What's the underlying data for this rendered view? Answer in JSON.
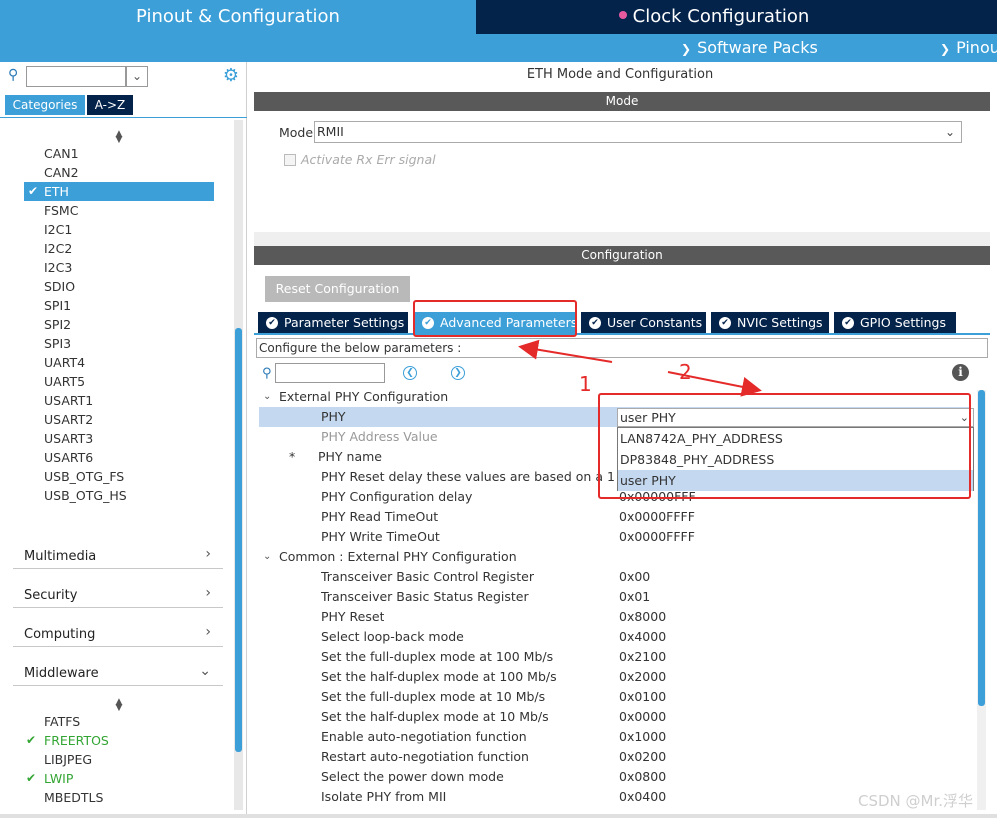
{
  "header": {
    "pinout_tab": "Pinout & Configuration",
    "clock_tab": "Clock Configuration",
    "software_packs": "Software Packs",
    "pinout_menu": "Pinout"
  },
  "left": {
    "categories_tab": "Categories",
    "az_tab": "A->Z",
    "connectivity_items": [
      "CAN1",
      "CAN2",
      "ETH",
      "FSMC",
      "I2C1",
      "I2C2",
      "I2C3",
      "SDIO",
      "SPI1",
      "SPI2",
      "SPI3",
      "UART4",
      "UART5",
      "USART1",
      "USART2",
      "USART3",
      "USART6",
      "USB_OTG_FS",
      "USB_OTG_HS"
    ],
    "groups": [
      "Multimedia",
      "Security",
      "Computing",
      "Middleware"
    ],
    "middleware_items": [
      "FATFS",
      "FREERTOS",
      "LIBJPEG",
      "LWIP",
      "MBEDTLS"
    ]
  },
  "main": {
    "title": "ETH Mode and Configuration",
    "mode_header": "Mode",
    "mode_label": "Mode",
    "mode_value": "RMII",
    "rx_err_label": "Activate Rx Err signal",
    "config_header": "Configuration",
    "reset_button": "Reset Configuration",
    "tabs": [
      "Parameter Settings",
      "Advanced Parameters",
      "User Constants",
      "NVIC Settings",
      "GPIO Settings"
    ],
    "configure_text": "Configure the below parameters :",
    "section1": "External PHY Configuration",
    "phy_rows": [
      {
        "name": "PHY",
        "value": ""
      },
      {
        "name": "PHY Address Value",
        "value": ""
      },
      {
        "name": "PHY name",
        "value": ""
      },
      {
        "name": "PHY Reset delay these values are based on a 1 ...",
        "value": ""
      },
      {
        "name": "PHY Configuration delay",
        "value": "0x00000FFF"
      },
      {
        "name": "PHY Read TimeOut",
        "value": "0x0000FFFF"
      },
      {
        "name": "PHY Write TimeOut",
        "value": "0x0000FFFF"
      }
    ],
    "phy_star": "*",
    "phy_select_value": "user PHY",
    "phy_options": [
      "LAN8742A_PHY_ADDRESS",
      "DP83848_PHY_ADDRESS",
      "user PHY"
    ],
    "section2": "Common : External PHY Configuration",
    "common_rows": [
      {
        "name": "Transceiver Basic Control Register",
        "value": "0x00"
      },
      {
        "name": "Transceiver Basic Status Register",
        "value": "0x01"
      },
      {
        "name": "PHY Reset",
        "value": "0x8000"
      },
      {
        "name": "Select loop-back mode",
        "value": "0x4000"
      },
      {
        "name": "Set the full-duplex mode at 100 Mb/s",
        "value": "0x2100"
      },
      {
        "name": "Set the half-duplex mode at 100 Mb/s",
        "value": "0x2000"
      },
      {
        "name": "Set the full-duplex mode at 10 Mb/s",
        "value": "0x0100"
      },
      {
        "name": "Set the half-duplex mode at 10 Mb/s",
        "value": "0x0000"
      },
      {
        "name": "Enable auto-negotiation function",
        "value": "0x1000"
      },
      {
        "name": "Restart auto-negotiation function",
        "value": "0x0200"
      },
      {
        "name": "Select the power down mode",
        "value": "0x0800"
      },
      {
        "name": "Isolate PHY from MII",
        "value": "0x0400"
      }
    ]
  },
  "annotations": {
    "label1": "1",
    "label2": "2"
  },
  "watermark": "CSDN @Mr.浮华",
  "colors": {
    "accent": "#3c9fd8",
    "dark_navy": "#03234b",
    "header_gray": "#595959",
    "annotation_red": "#e52a2a",
    "check_green": "#33a533"
  }
}
